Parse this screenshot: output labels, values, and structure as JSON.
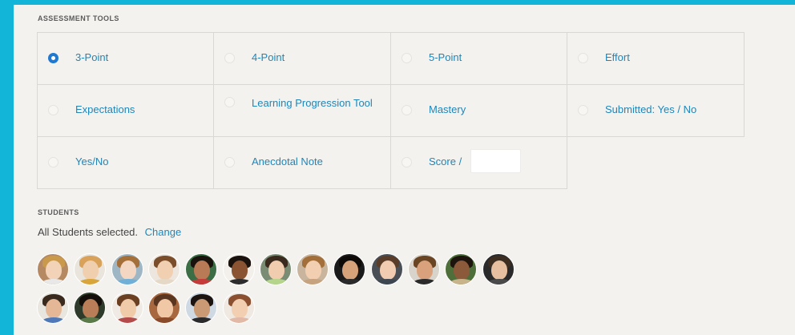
{
  "assessment_tools": {
    "title": "ASSESSMENT TOOLS",
    "options": [
      {
        "label": "3-Point",
        "checked": true
      },
      {
        "label": "4-Point",
        "checked": false
      },
      {
        "label": "5-Point",
        "checked": false
      },
      {
        "label": "Effort",
        "checked": false
      },
      {
        "label": "Expectations",
        "checked": false
      },
      {
        "label": "Learning Progression Tool",
        "checked": false
      },
      {
        "label": "Mastery",
        "checked": false
      },
      {
        "label": "Submitted: Yes / No",
        "checked": false
      },
      {
        "label": "Yes/No",
        "checked": false
      },
      {
        "label": "Anecdotal Note",
        "checked": false
      },
      {
        "label": "Score /",
        "checked": false,
        "input_value": ""
      }
    ]
  },
  "students": {
    "title": "STUDENTS",
    "selection_text": "All Students selected.",
    "change_link": "Change",
    "avatars": [
      {
        "bg": "#b58a63",
        "hair": "#c99a4c",
        "face": "#f2d3b8",
        "shirt": "#e8e8e8"
      },
      {
        "bg": "#e9e4dc",
        "hair": "#d9a25a",
        "face": "#f0cfae",
        "shirt": "#d9a53a"
      },
      {
        "bg": "#9fb7c4",
        "hair": "#a56f3a",
        "face": "#f4d7c2",
        "shirt": "#6fb0d8"
      },
      {
        "bg": "#ece6de",
        "hair": "#7a4d2b",
        "face": "#f1cfb1",
        "shirt": "#e6d8c6"
      },
      {
        "bg": "#3b6e45",
        "hair": "#1a120c",
        "face": "#b97b55",
        "shirt": "#c63a3a"
      },
      {
        "bg": "#f3f0eb",
        "hair": "#1a120c",
        "face": "#8a5432",
        "shirt": "#2c2c2c"
      },
      {
        "bg": "#7a8d74",
        "hair": "#3a2a1e",
        "face": "#f1cdb0",
        "shirt": "#b5d68a"
      },
      {
        "bg": "#c9b59d",
        "hair": "#a26e3a",
        "face": "#f2cfb0",
        "shirt": "#c7a27e"
      },
      {
        "bg": "#1a1a1a",
        "hair": "#0d0a08",
        "face": "#d6a27a",
        "shirt": "#2a2a2a"
      },
      {
        "bg": "#4a4f55",
        "hair": "#5a3d28",
        "face": "#f1ccb0",
        "shirt": "#3d4650"
      },
      {
        "bg": "#d9d4cb",
        "hair": "#6a4524",
        "face": "#d9a27c",
        "shirt": "#2a2a2a"
      },
      {
        "bg": "#4f6f3a",
        "hair": "#1d140e",
        "face": "#8a5a3a",
        "shirt": "#c9b38a"
      },
      {
        "bg": "#2a2a2a",
        "hair": "#3d2e22",
        "face": "#e6bfa0",
        "shirt": "#4a4a4a"
      },
      {
        "bg": "#e9e6e0",
        "hair": "#3a2a1e",
        "face": "#e4b896",
        "shirt": "#4f78b8"
      },
      {
        "bg": "#2f3b2a",
        "hair": "#140e0a",
        "face": "#b97e58",
        "shirt": "#5a7a4a"
      },
      {
        "bg": "#efeae3",
        "hair": "#6a3f22",
        "face": "#f0cbaa",
        "shirt": "#b44a4a"
      },
      {
        "bg": "#a8683f",
        "hair": "#5a3520",
        "face": "#f0c8a6",
        "shirt": "#8b4a2a"
      },
      {
        "bg": "#cfd9e3",
        "hair": "#1c1410",
        "face": "#c99a74",
        "shirt": "#2a2a2a"
      },
      {
        "bg": "#efe9e1",
        "hair": "#8a5030",
        "face": "#f2cfb0",
        "shirt": "#e2b8a6"
      }
    ]
  },
  "colors": {
    "frame": "#12b4d8",
    "panel": "#f3f2ef",
    "link": "#1f86b9",
    "radio_selected": "#1f78d1"
  }
}
